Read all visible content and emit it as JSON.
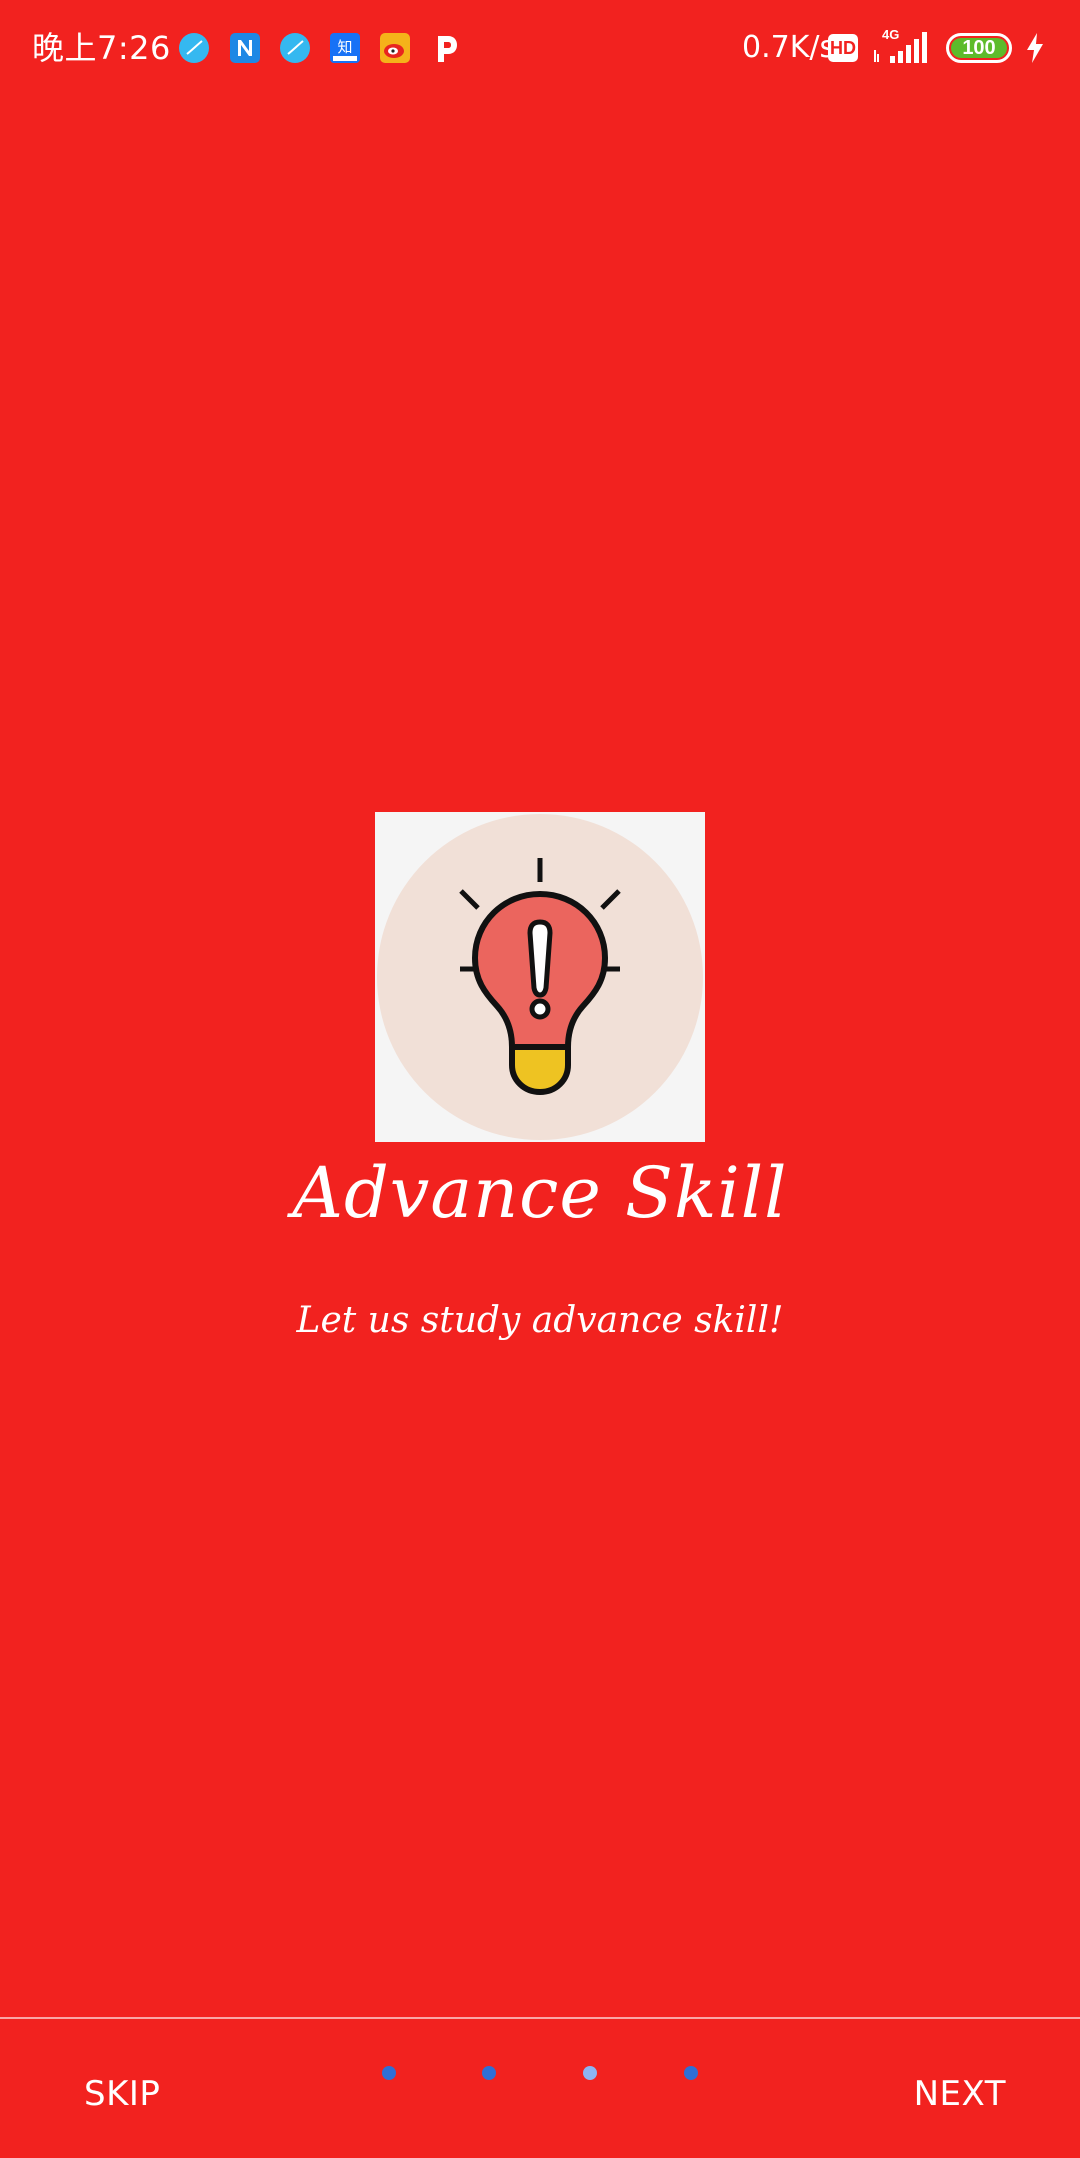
{
  "status_bar": {
    "time": "晚上7:26",
    "net_speed": "0.7K/s",
    "hd_label": "HD",
    "network_type": "4G",
    "battery_level": "100",
    "notification_icons": [
      "blue-app-icon",
      "n-app-icon",
      "blue-app-icon",
      "zhihu-app-icon",
      "weibo-app-icon",
      "p-app-icon"
    ]
  },
  "onboarding": {
    "title": "Advance Skill",
    "subtitle": "Let us study advance skill!",
    "illustration_icon": "lightbulb-exclamation-icon"
  },
  "bottom_bar": {
    "skip_label": "SKIP",
    "next_label": "NEXT",
    "page_count": 4,
    "active_page": 3
  },
  "colors": {
    "background": "#F2221F",
    "dot_inactive": "#2F6FD6",
    "dot_active": "#8DB4F2",
    "bulb_red": "#EB655E",
    "bulb_base": "#EEC322",
    "circle_bg": "#F1E0D7"
  }
}
